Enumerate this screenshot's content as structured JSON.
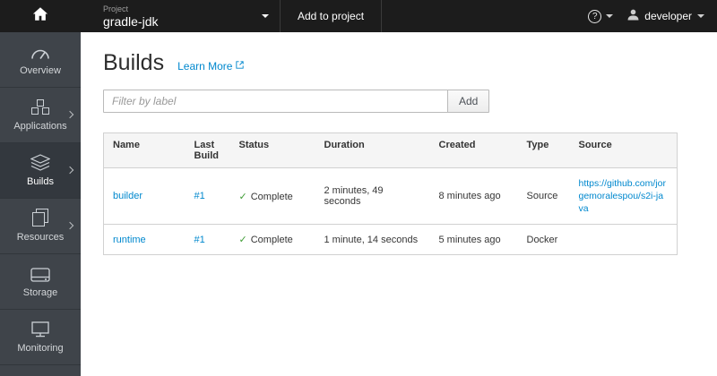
{
  "topbar": {
    "project_label": "Project",
    "project_name": "gradle-jdk",
    "add_to_project_label": "Add to project",
    "user_name": "developer"
  },
  "sidebar": {
    "items": [
      {
        "label": "Overview",
        "icon": "dashboard-icon",
        "expandable": false,
        "active": false
      },
      {
        "label": "Applications",
        "icon": "cubes-icon",
        "expandable": true,
        "active": false
      },
      {
        "label": "Builds",
        "icon": "builds-icon",
        "expandable": true,
        "active": true
      },
      {
        "label": "Resources",
        "icon": "resources-icon",
        "expandable": true,
        "active": false
      },
      {
        "label": "Storage",
        "icon": "storage-icon",
        "expandable": false,
        "active": false
      },
      {
        "label": "Monitoring",
        "icon": "monitoring-icon",
        "expandable": false,
        "active": false
      }
    ]
  },
  "page": {
    "title": "Builds",
    "learn_more_label": "Learn More",
    "filter_placeholder": "Filter by label",
    "add_button_label": "Add"
  },
  "builds_table": {
    "headers": [
      "Name",
      "Last Build",
      "Status",
      "Duration",
      "Created",
      "Type",
      "Source"
    ],
    "rows": [
      {
        "name": "builder",
        "last_build": "#1",
        "status": "Complete",
        "duration": "2 minutes, 49 seconds",
        "created": "8 minutes ago",
        "type": "Source",
        "source_url": "https://github.com/jorgemoralespou/s2i-java"
      },
      {
        "name": "runtime",
        "last_build": "#1",
        "status": "Complete",
        "duration": "1 minute, 14 seconds",
        "created": "5 minutes ago",
        "type": "Docker",
        "source_url": ""
      }
    ]
  },
  "icons": {
    "help_glyph": "?",
    "check_glyph": "✓"
  },
  "colors": {
    "link": "#0088ce",
    "success_check": "#3f9c35",
    "topbar_bg": "#1c1c1c",
    "sidebar_bg": "#3f444a"
  }
}
